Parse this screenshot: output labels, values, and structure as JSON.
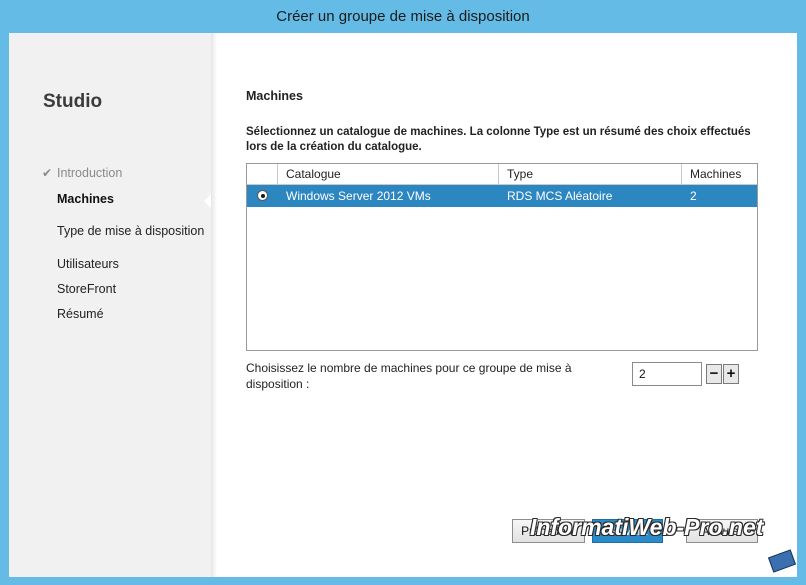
{
  "window": {
    "title": "Créer un groupe de mise à disposition"
  },
  "sidebar": {
    "title": "Studio",
    "check_icon": "✔",
    "steps": [
      {
        "label": "Introduction",
        "state": "done"
      },
      {
        "label": "Machines",
        "state": "current"
      },
      {
        "label": "Type de mise à disposition",
        "state": "pending"
      },
      {
        "label": "Utilisateurs",
        "state": "pending"
      },
      {
        "label": "StoreFront",
        "state": "pending"
      },
      {
        "label": "Résumé",
        "state": "pending"
      }
    ]
  },
  "main": {
    "section_title": "Machines",
    "instructions": "Sélectionnez un catalogue de machines. La colonne Type est un résumé des choix effectués lors de la création du catalogue.",
    "table": {
      "columns": [
        "Catalogue",
        "Type",
        "Machines"
      ],
      "rows": [
        {
          "selected": true,
          "catalogue": "Windows Server 2012 VMs",
          "type": "RDS MCS Aléatoire",
          "machines": "2"
        }
      ]
    },
    "count_label": "Choisissez le nombre de machines pour ce groupe de mise à disposition :",
    "count_value": "2",
    "stepper": {
      "decrement": "−",
      "increment": "+"
    }
  },
  "buttons": {
    "previous": "Précédent",
    "next": "Suivant",
    "cancel": "Annuler"
  },
  "watermark": "InformatiWeb-Pro.net",
  "colors": {
    "frame": "#63bbe6",
    "selection": "#2c86c0",
    "primary_button": "#2d8ac8"
  }
}
